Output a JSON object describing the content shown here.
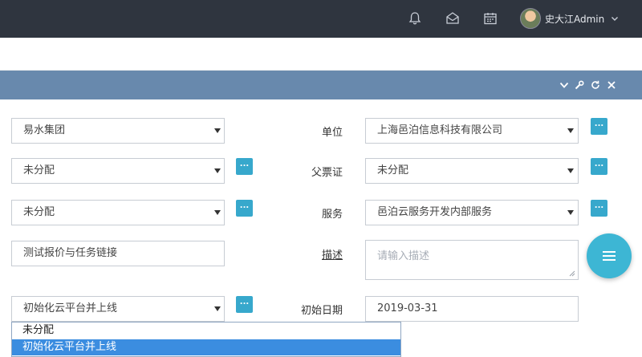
{
  "header": {
    "username": "史大江Admin",
    "icons": [
      "bell-icon",
      "envelope-icon",
      "calendar-icon",
      "chevron-down-icon"
    ]
  },
  "panel": {
    "icons": [
      "chevron-down-icon",
      "wrench-icon",
      "refresh-icon",
      "close-icon"
    ]
  },
  "form": {
    "row1": {
      "left_value": "易水集团",
      "right_label": "单位",
      "right_value": "上海邑泊信息科技有限公司"
    },
    "row2": {
      "left_value": "未分配",
      "right_label": "父票证",
      "right_value": "未分配"
    },
    "row3": {
      "left_value": "未分配",
      "right_label": "服务",
      "right_value": "邑泊云服务开发内部服务"
    },
    "row4": {
      "left_value": "测试报价与任务链接",
      "right_label": "描述",
      "right_placeholder": "请输入描述"
    },
    "row5": {
      "left_value": "初始化云平台并上线",
      "right_label": "初始日期",
      "right_value": "2019-03-31"
    },
    "picker_label": "..."
  },
  "dropdown": {
    "options": [
      {
        "label": "未分配",
        "selected": false
      },
      {
        "label": "初始化云平台并上线",
        "selected": true
      }
    ]
  },
  "colors": {
    "topbar": "#2f353f",
    "panel_header": "#6889ad",
    "picker": "#37a8cc",
    "fab": "#3db6d4",
    "option_selected": "#3b8de0"
  },
  "fab_icon": "menu-icon"
}
